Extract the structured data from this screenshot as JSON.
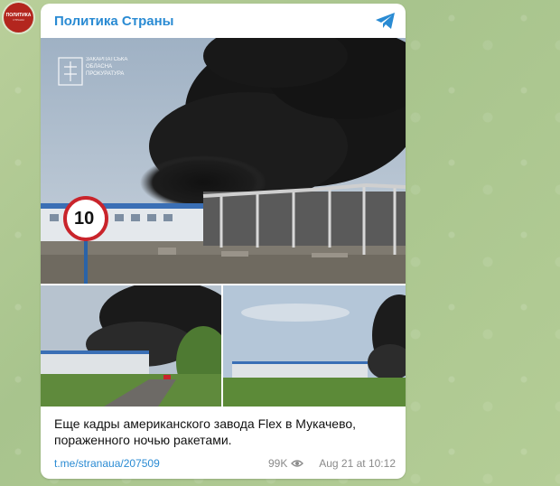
{
  "avatar": {
    "line1": "ПОЛИТИКА",
    "line2": "СТРАНЫ"
  },
  "header": {
    "channel_name": "Политика Страны"
  },
  "photo_main": {
    "watermark_line1": "ЗАКАРПАТСЬКА",
    "watermark_line2": "ОБЛАСНА",
    "watermark_line3": "ПРОКУРАТУРА",
    "speed_sign": "10"
  },
  "caption": {
    "line1": "Еще кадры американского завода Flex в Мукачево,",
    "line2": "пораженного ночью ракетами."
  },
  "footer": {
    "link": "t.me/stranaua/207509",
    "views": "99K",
    "date": "Aug 21 at 10:12"
  },
  "colors": {
    "accent": "#2a8bd3",
    "avatar": "#b3261e"
  }
}
